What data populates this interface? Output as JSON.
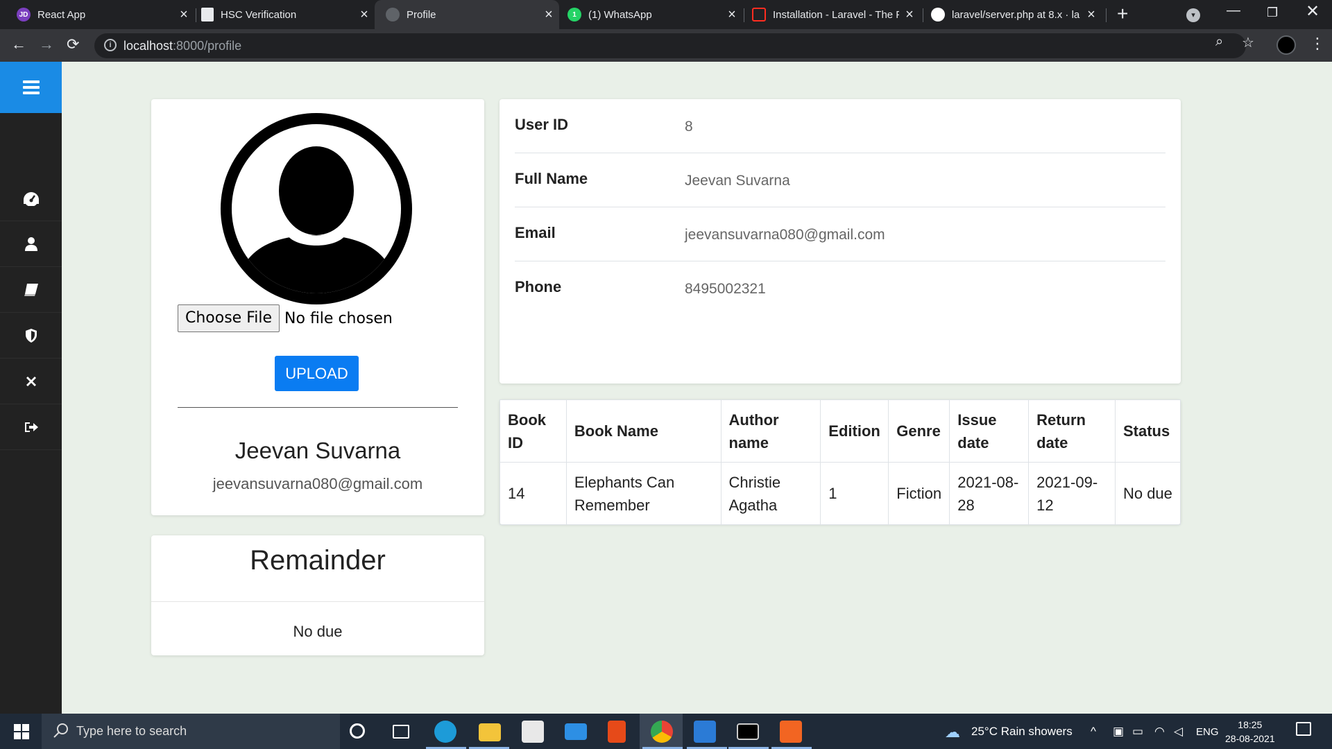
{
  "browser": {
    "tabs": [
      {
        "title": "React App",
        "favicon_text": "JD",
        "favicon_color": "#7b3fbf",
        "active": false
      },
      {
        "title": "HSC Verification",
        "favicon_text": "",
        "favicon_color": "#e8eaed",
        "active": false
      },
      {
        "title": "Profile",
        "favicon_text": "",
        "favicon_color": "#5f6368",
        "active": true
      },
      {
        "title": "(1) WhatsApp",
        "favicon_text": "1",
        "favicon_color": "#25d366",
        "active": false
      },
      {
        "title": "Installation - Laravel - The P",
        "favicon_text": "",
        "favicon_color": "#ff2d20",
        "active": false
      },
      {
        "title": "laravel/server.php at 8.x · la",
        "favicon_text": "",
        "favicon_color": "#ffffff",
        "active": false
      }
    ],
    "url_host": "localhost",
    "url_path": ":8000/profile"
  },
  "sidebar": {
    "items": [
      "menu-icon",
      "dashboard-icon",
      "user-icon",
      "books-icon",
      "shield-icon",
      "close-icon",
      "logout-icon"
    ],
    "accent": "#1a8be5"
  },
  "profile": {
    "file_button": "Choose File",
    "file_status": "No file chosen",
    "upload_label": "UPLOAD",
    "name": "Jeevan Suvarna",
    "email": "jeevansuvarna080@gmail.com"
  },
  "reminder": {
    "title": "Remainder",
    "text": "No due"
  },
  "details": {
    "rows": [
      {
        "label": "User ID",
        "value": "8"
      },
      {
        "label": "Full Name",
        "value": "Jeevan Suvarna"
      },
      {
        "label": "Email",
        "value": "jeevansuvarna080@gmail.com"
      },
      {
        "label": "Phone",
        "value": "8495002321"
      }
    ]
  },
  "books": {
    "headers": [
      "Book ID",
      "Book Name",
      "Author name",
      "Edition",
      "Genre",
      "Issue date",
      "Return date",
      "Status"
    ],
    "rows": [
      [
        "14",
        "Elephants Can Remember",
        "Christie Agatha",
        "1",
        "Fiction",
        "2021-08-28",
        "2021-09-12",
        "No due"
      ]
    ]
  },
  "taskbar": {
    "search_placeholder": "Type here to search",
    "weather": "25°C  Rain showers",
    "lang": "ENG",
    "time": "18:25",
    "date": "28-08-2021"
  }
}
